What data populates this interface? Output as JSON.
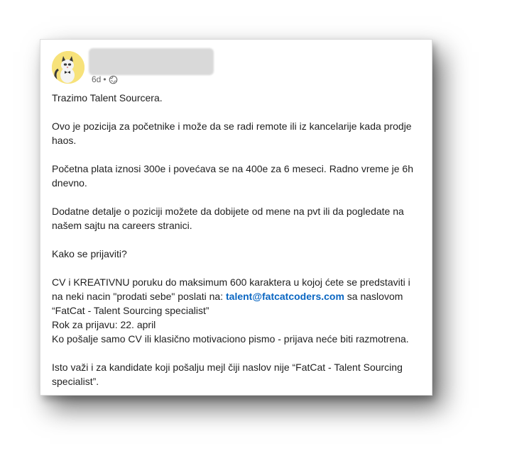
{
  "post": {
    "age": "6d",
    "separator": "•",
    "visibility_icon": "globe-icon",
    "lines": {
      "p1": "Trazimo Talent Sourcera.",
      "p2": "Ovo je pozicija za početnike i može da se radi remote ili iz kancelarije kada prodje haos.",
      "p3": "Početna plata iznosi 300e i povećava se na 400e za 6 meseci. Radno vreme je 6h dnevno.",
      "p4": "Dodatne detalje o poziciji možete da dobijete od mene na pvt ili da pogledate na našem sajtu na careers stranici.",
      "p5": "Kako se prijaviti?",
      "p6_before": "CV i KREATIVNU poruku do maksimum 600 karaktera u kojoj ćete se predstaviti i na neki nacin \"prodati sebe\" poslati na: ",
      "p6_email": "talent@fatcatcoders.com",
      "p6_after": " sa naslovom “FatCat - Talent Sourcing specialist”",
      "p7": "Rok za prijavu: 22. april",
      "p8": "Ko pošalje samo CV ili klasično motivaciono pismo - prijava neće biti razmotrena.",
      "p9": "Isto važi i za kandidate koji pošalju mejl čiji naslov nije “FatCat - Talent Sourcing specialist”."
    }
  },
  "colors": {
    "link": "#0a66c2",
    "avatar_bg": "#f7e27a",
    "text": "#1f1f1f",
    "meta": "#666666"
  }
}
